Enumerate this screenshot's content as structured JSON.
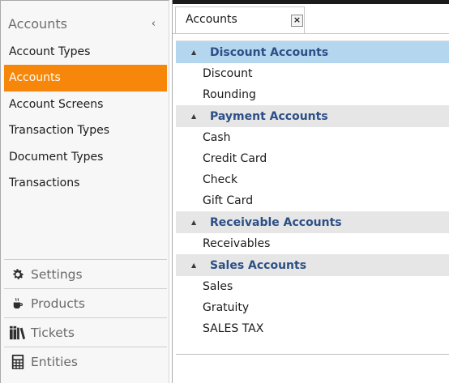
{
  "left_panel": {
    "title": "Accounts",
    "collapse_glyph": "‹",
    "items": [
      {
        "label": "Account Types",
        "active": false
      },
      {
        "label": "Accounts",
        "active": true
      },
      {
        "label": "Account Screens",
        "active": false
      },
      {
        "label": "Transaction Types",
        "active": false
      },
      {
        "label": "Document Types",
        "active": false
      },
      {
        "label": "Transactions",
        "active": false
      }
    ],
    "bottom_nav": [
      {
        "label": "Settings",
        "icon": "gear-icon"
      },
      {
        "label": "Products",
        "icon": "coffee-cup-icon"
      },
      {
        "label": "Tickets",
        "icon": "books-icon"
      },
      {
        "label": "Entities",
        "icon": "calculator-icon"
      }
    ]
  },
  "colors": {
    "accent": "#f6870b",
    "selected_group": "#b5d6ef",
    "group_header": "#e6e6e6",
    "group_text": "#2c4f86"
  },
  "tab": {
    "label": "Accounts",
    "close_glyph": "×"
  },
  "groups": [
    {
      "name": "Discount Accounts",
      "selected": true,
      "items": [
        "Discount",
        "Rounding"
      ]
    },
    {
      "name": "Payment Accounts",
      "selected": false,
      "items": [
        "Cash",
        "Credit Card",
        "Check",
        "Gift Card"
      ]
    },
    {
      "name": "Receivable Accounts",
      "selected": false,
      "items": [
        "Receivables"
      ]
    },
    {
      "name": "Sales Accounts",
      "selected": false,
      "items": [
        "Sales",
        "Gratuity",
        "SALES TAX"
      ]
    }
  ]
}
